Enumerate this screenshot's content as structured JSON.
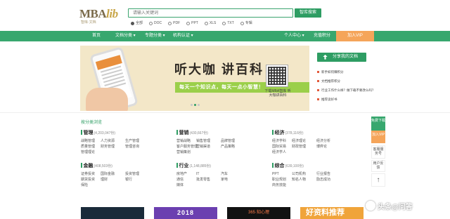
{
  "header": {
    "logo_main": "MBA",
    "logo_lib": "lib",
    "logo_sub": "智库·文档",
    "search_placeholder": "请输入关键词",
    "search_button": "智库搜索",
    "filters": [
      {
        "label": "全部",
        "checked": true
      },
      {
        "label": "DOC",
        "checked": false
      },
      {
        "label": "PDF",
        "checked": false
      },
      {
        "label": "PPT",
        "checked": false
      },
      {
        "label": "XLS",
        "checked": false
      },
      {
        "label": "TXT",
        "checked": false
      },
      {
        "label": "专辑",
        "checked": false
      }
    ]
  },
  "nav": {
    "items": [
      "首页",
      "文档分类 ▾",
      "专题分类 ▾",
      "机构认证 ▾"
    ],
    "user_center": "个人中心 ▾",
    "points": "充值积分",
    "vip": "加入VIP"
  },
  "banner": {
    "title": "听大咖 讲百科",
    "slogan": "每天一个知识点，每天一点小智慧！",
    "qr_caption": "下载MBA智库 听大咖讲百科"
  },
  "sidebar": {
    "share_button": "分享我的文档",
    "links": [
      "新手如何赚积分",
      "文档推荐积分",
      "行业工作什么样？做下载不要改么吗？",
      "推荐读好书"
    ]
  },
  "categories": {
    "title": "按分类浏览",
    "blocks": [
      {
        "name": "管理",
        "count": "(4,203,047份)",
        "items": [
          "战略管理",
          "人力资源",
          "生产管理",
          "质量管理",
          "财务管理",
          "管理咨询",
          "管理理论"
        ]
      },
      {
        "name": "营销",
        "count": "(430,667份)",
        "items": [
          "营销战略",
          "销售管理",
          "品牌管理",
          "客户服务管理",
          "营销渠道",
          "产品策略",
          "营销策划"
        ]
      },
      {
        "name": "经济",
        "count": "(378,116份)",
        "items": [
          "经济学科",
          "经济理论",
          "经济分析",
          "国际贸易",
          "财政管理",
          "博弈论",
          "经济学人"
        ]
      },
      {
        "name": "金融",
        "count": "(408,503份)",
        "items": [
          "证券投资",
          "国际金融",
          "投资管理",
          "期货投资",
          "理财",
          "银行",
          "保险"
        ]
      },
      {
        "name": "行业",
        "count": "(1,148,885份)",
        "items": [
          "房地产",
          "IT",
          "汽车",
          "通信",
          "批发零售",
          "家电",
          "媒体"
        ]
      },
      {
        "name": "综合",
        "count": "(639,100份)",
        "items": [
          "PPT",
          "公司机构",
          "行业报告",
          "职业规划",
          "知名人物",
          "励志成功",
          "商务技能"
        ]
      }
    ]
  },
  "float": {
    "download": "免费下载",
    "vip": "加入VIP",
    "service": "客服服务号",
    "user": "用户反馈",
    "top": "↑"
  },
  "thumbs": [
    "",
    "2018",
    "365·知心理",
    "好资料推荐"
  ],
  "watermark": "头条@问答"
}
